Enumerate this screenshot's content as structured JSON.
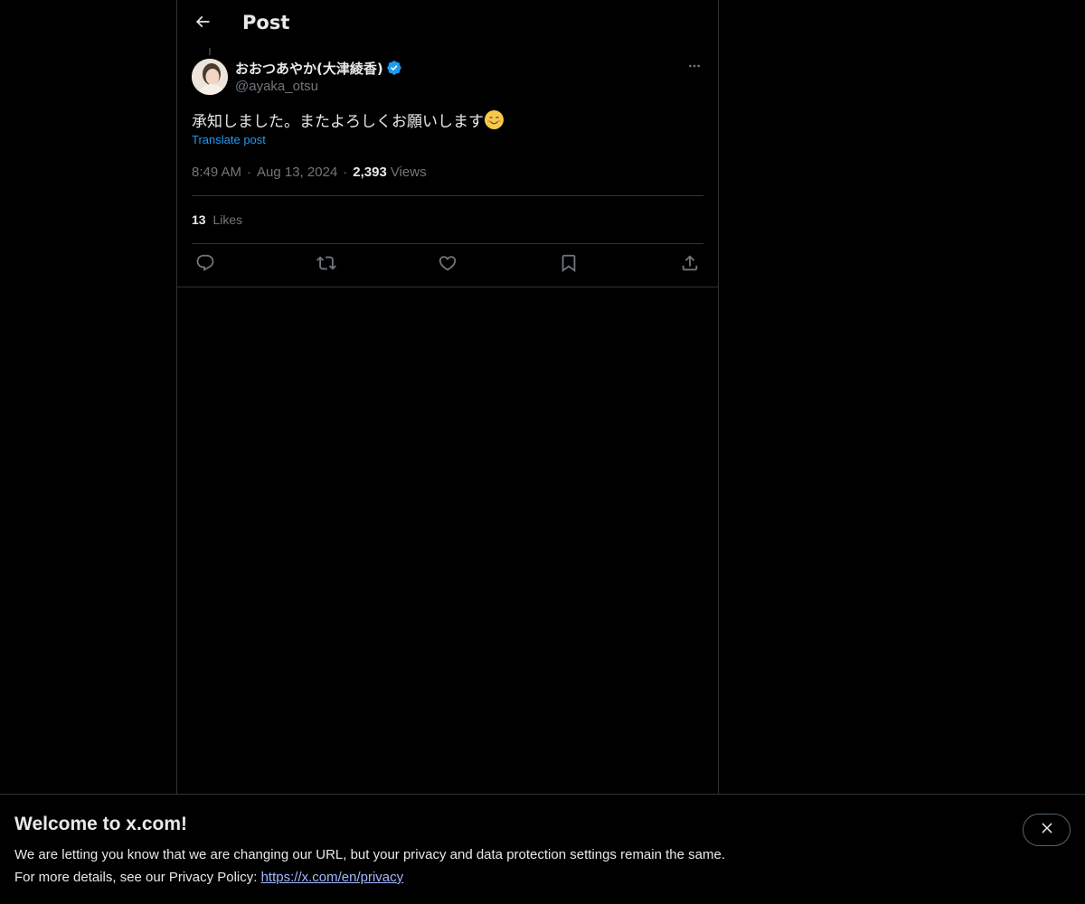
{
  "header": {
    "title": "Post"
  },
  "post": {
    "author_name": "おおつあやか(大津綾香)",
    "author_handle": "@ayaka_otsu",
    "text": "承知しました。またよろしくお願いします",
    "translate_label": "Translate post",
    "time": "8:49 AM",
    "date": "Aug 13, 2024",
    "views_count": "2,393",
    "views_label": "Views",
    "likes_count": "13",
    "likes_label": "Likes"
  },
  "icons": {
    "back": "arrow-left-icon",
    "verified": "verified-badge-icon",
    "more": "more-horizontal-icon",
    "reply": "reply-icon",
    "repost": "repost-icon",
    "like": "heart-icon",
    "bookmark": "bookmark-icon",
    "share": "share-icon",
    "close": "close-icon",
    "emoji": "smiling-face-emoji"
  },
  "banner": {
    "title": "Welcome to x.com!",
    "line1": "We are letting you know that we are changing our URL, but your privacy and data protection settings remain the same.",
    "line2_prefix": "For more details, see our Privacy Policy: ",
    "link": "https://x.com/en/privacy"
  },
  "colors": {
    "background": "#000000",
    "text_primary": "#e7e9ea",
    "text_secondary": "#71767b",
    "accent": "#1d9bf0",
    "border": "#2f3336",
    "link": "#a3b8ff"
  }
}
